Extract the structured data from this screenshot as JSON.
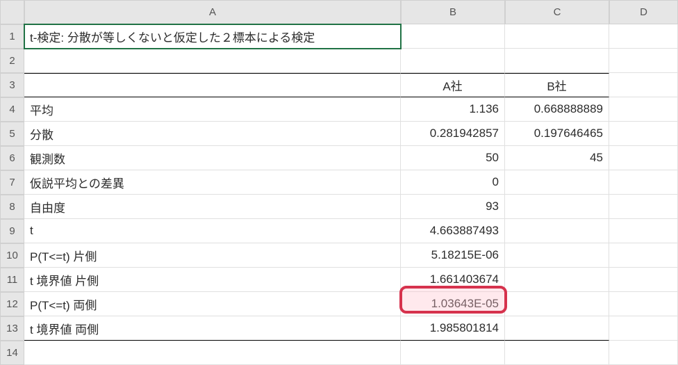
{
  "chart_data": {
    "type": "table",
    "title": "t-検定: 分散が等しくないと仮定した２標本による検定",
    "series": [
      "A社",
      "B社"
    ],
    "rows": [
      {
        "label": "平均",
        "A社": 1.136,
        "B社": 0.668888889
      },
      {
        "label": "分散",
        "A社": 0.281942857,
        "B社": 0.197646465
      },
      {
        "label": "観測数",
        "A社": 50,
        "B社": 45
      },
      {
        "label": "仮説平均との差異",
        "A社": 0,
        "B社": null
      },
      {
        "label": "自由度",
        "A社": 93,
        "B社": null
      },
      {
        "label": "t",
        "A社": 4.663887493,
        "B社": null
      },
      {
        "label": "P(T<=t) 片側",
        "A社": "5.18215E-06",
        "B社": null
      },
      {
        "label": "t 境界値 片側",
        "A社": 1.661403674,
        "B社": null
      },
      {
        "label": "P(T<=t) 両側",
        "A社": "1.03643E-05",
        "B社": null
      },
      {
        "label": "t 境界値 両側",
        "A社": 1.985801814,
        "B社": null
      }
    ],
    "highlighted_row": 8
  },
  "col_headers": {
    "A": "A",
    "B": "B",
    "C": "C",
    "D": "D"
  },
  "row_headers": {
    "1": "1",
    "2": "2",
    "3": "3",
    "4": "4",
    "5": "5",
    "6": "6",
    "7": "7",
    "8": "8",
    "9": "9",
    "10": "10",
    "11": "11",
    "12": "12",
    "13": "13",
    "14": "14"
  },
  "cells": {
    "A1": "t-検定: 分散が等しくないと仮定した２標本による検定",
    "B3": "A社",
    "C3": "B社",
    "A4": "平均",
    "B4": "1.136",
    "C4": "0.668888889",
    "A5": "分散",
    "B5": "0.281942857",
    "C5": "0.197646465",
    "A6": "観測数",
    "B6": "50",
    "C6": "45",
    "A7": "仮説平均との差異",
    "B7": "0",
    "A8": "自由度",
    "B8": "93",
    "A9": "t",
    "B9": "4.663887493",
    "A10": "P(T<=t) 片側",
    "B10": "5.18215E-06",
    "A11": "t 境界値 片側",
    "B11": "1.661403674",
    "A12": "P(T<=t) 両側",
    "B12": "1.03643E-05",
    "A13": "t 境界値 両側",
    "B13": "1.985801814"
  },
  "highlight_cell": "B12"
}
